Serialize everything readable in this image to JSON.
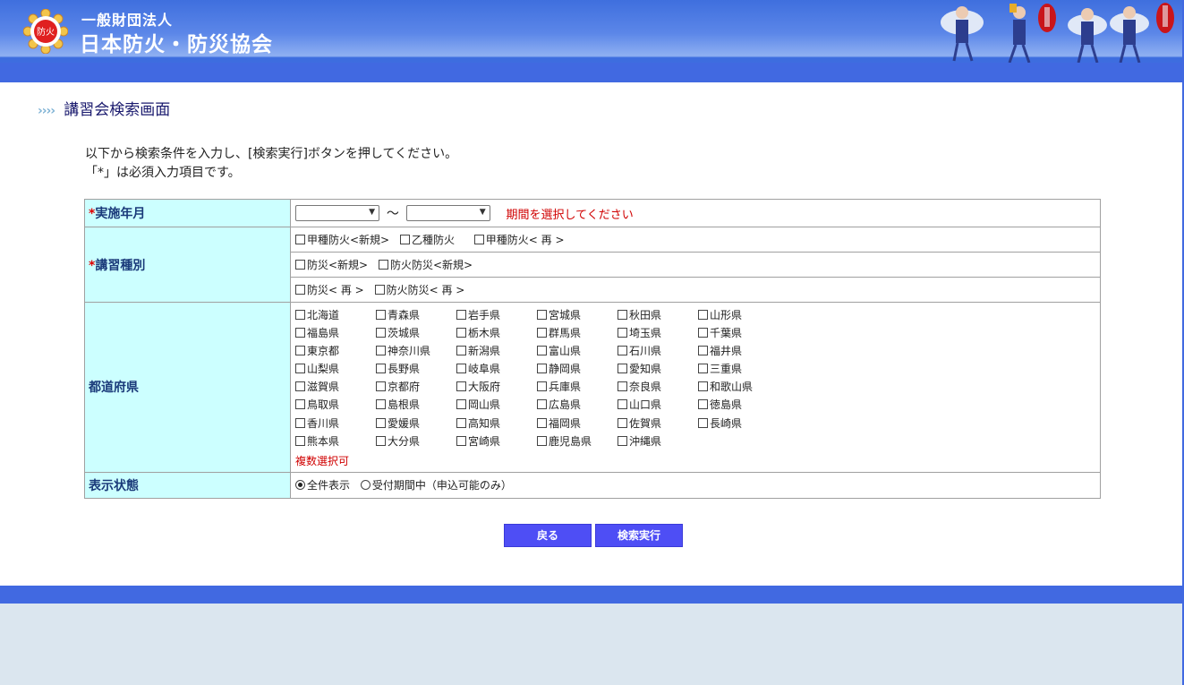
{
  "header": {
    "org_type": "一般財団法人",
    "org_name": "日本防火・防災協会",
    "logo_text": "防火",
    "brand_color": "#4169e1"
  },
  "page": {
    "title_arrows": "››››",
    "title": "講習会検索画面",
    "instruction_1": "以下から検索条件を入力し、[検索実行]ボタンを押してください。",
    "instruction_2": "「*」は必須入力項目です。"
  },
  "form": {
    "period": {
      "label": "実施年月",
      "required_mark": "*",
      "from_value": "",
      "to_value": "",
      "separator": "～",
      "error": "期間を選択してください"
    },
    "course_type": {
      "label": "講習種別",
      "required_mark": "*",
      "rows": [
        [
          "甲種防火<新規>",
          "乙種防火",
          "甲種防火< 再 >"
        ],
        [
          "防災<新規>",
          "防火防災<新規>"
        ],
        [
          "防災< 再 >",
          "防火防災< 再 >"
        ]
      ]
    },
    "prefecture": {
      "label": "都道府県",
      "rows": [
        [
          "北海道",
          "青森県",
          "岩手県",
          "宮城県",
          "秋田県",
          "山形県"
        ],
        [
          "福島県",
          "茨城県",
          "栃木県",
          "群馬県",
          "埼玉県",
          "千葉県"
        ],
        [
          "東京都",
          "神奈川県",
          "新潟県",
          "富山県",
          "石川県",
          "福井県"
        ],
        [
          "山梨県",
          "長野県",
          "岐阜県",
          "静岡県",
          "愛知県",
          "三重県"
        ],
        [
          "滋賀県",
          "京都府",
          "大阪府",
          "兵庫県",
          "奈良県",
          "和歌山県"
        ],
        [
          "鳥取県",
          "島根県",
          "岡山県",
          "広島県",
          "山口県",
          "徳島県"
        ],
        [
          "香川県",
          "愛媛県",
          "高知県",
          "福岡県",
          "佐賀県",
          "長崎県"
        ],
        [
          "熊本県",
          "大分県",
          "宮崎県",
          "鹿児島県",
          "沖縄県"
        ]
      ],
      "note": "複数選択可"
    },
    "display": {
      "label": "表示状態",
      "options": [
        {
          "label": "全件表示",
          "selected": true
        },
        {
          "label": "受付期間中（申込可能のみ）",
          "selected": false
        }
      ]
    }
  },
  "buttons": {
    "back": "戻る",
    "search": "検索実行",
    "color": "#4e4ef5"
  }
}
